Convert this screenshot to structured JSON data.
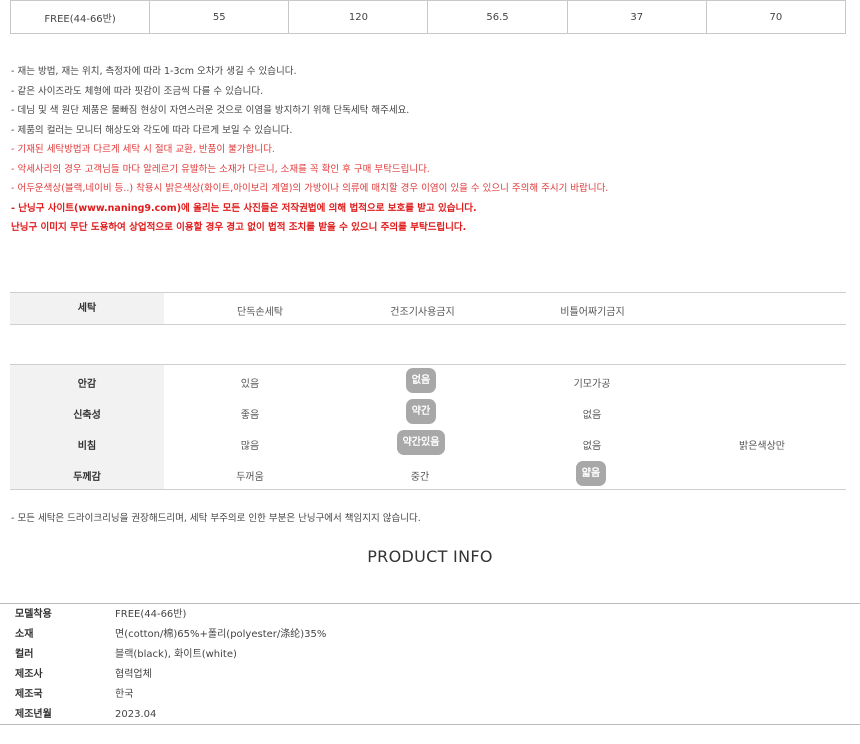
{
  "size_table": {
    "cells": [
      "FREE(44-66반)",
      "55",
      "120",
      "56.5",
      "37",
      "70"
    ]
  },
  "notes": [
    {
      "text": "- 재는 방법, 재는 위치, 측정자에 따라 1-3cm 오차가 생길 수 있습니다.",
      "style": "normal"
    },
    {
      "text": "- 같은 사이즈라도 체형에 따라 핏감이 조금씩 다를 수 있습니다.",
      "style": "normal"
    },
    {
      "text": "- 데님 및 색 원단 제품은 물빠짐 현상이 자연스러운 것으로 이염을 방지하기 위해 단독세탁 해주세요.",
      "style": "normal"
    },
    {
      "text": "- 제품의 컬러는 모니터 해상도와 각도에 따라 다르게 보일 수 있습니다.",
      "style": "normal"
    },
    {
      "text": "- 기재된 세탁방법과 다르게 세탁 시 절대 교환, 반품이 불가합니다.",
      "style": "red"
    },
    {
      "text": "- 악세사리의 경우 고객님들 마다 알레르기 유발하는 소재가 다르니, 소재를 꼭 확인 후 구매 부탁드립니다.",
      "style": "red"
    },
    {
      "text": "- 어두운색상(블랙,네이비 등..) 착용시 밝은색상(화이트,아이보리 계열)의 가방이나 의류에 매치할 경우 이염이 있을 수 있으니 주의해 주시기 바랍니다.",
      "style": "red"
    },
    {
      "text": "- 난닝구 사이트(www.naning9.com)에 올리는 모든 사진들은 저작권법에 의해 법적으로 보호를 받고 있습니다.",
      "style": "bold"
    },
    {
      "text": "난닝구 이미지 무단 도용하여 상업적으로 이용할 경우 경고 없이 법적 조치를 받을 수 있으니 주의를 부탁드립니다.",
      "style": "bold"
    }
  ],
  "washing": {
    "label": "세탁",
    "options": [
      "단독손세탁",
      "건조기사용금지",
      "비틀어짜기금지"
    ]
  },
  "fabric": {
    "rows": [
      {
        "label": "안감",
        "options": [
          "있음",
          "없음",
          "기모가공",
          ""
        ],
        "selected": 1
      },
      {
        "label": "신축성",
        "options": [
          "좋음",
          "약간",
          "없음",
          ""
        ],
        "selected": 1
      },
      {
        "label": "비침",
        "options": [
          "많음",
          "약간있음",
          "없음",
          "밝은색상만"
        ],
        "selected": 1
      },
      {
        "label": "두께감",
        "options": [
          "두꺼움",
          "중간",
          "얇음",
          ""
        ],
        "selected": 2
      }
    ]
  },
  "footnote": "- 모든 세탁은 드라이크리닝을 권장해드리며, 세탁 부주의로 인한 부분은 난닝구에서 책임지지 않습니다.",
  "product_info": {
    "title": "PRODUCT INFO",
    "rows": [
      {
        "label": "모델착용",
        "value": "FREE(44-66반)"
      },
      {
        "label": "소재",
        "value": "면(cotton/棉)65%+폴리(polyester/涤纶)35%"
      },
      {
        "label": "컬러",
        "value": "블랙(black), 화이트(white)"
      },
      {
        "label": "제조사",
        "value": "협력업체"
      },
      {
        "label": "제조국",
        "value": "한국"
      },
      {
        "label": "제조년월",
        "value": "2023.04"
      }
    ]
  },
  "colors": {
    "red": "#e03a3a",
    "pill": "#a8a8a8",
    "header_bg": "#f2f2f2"
  }
}
